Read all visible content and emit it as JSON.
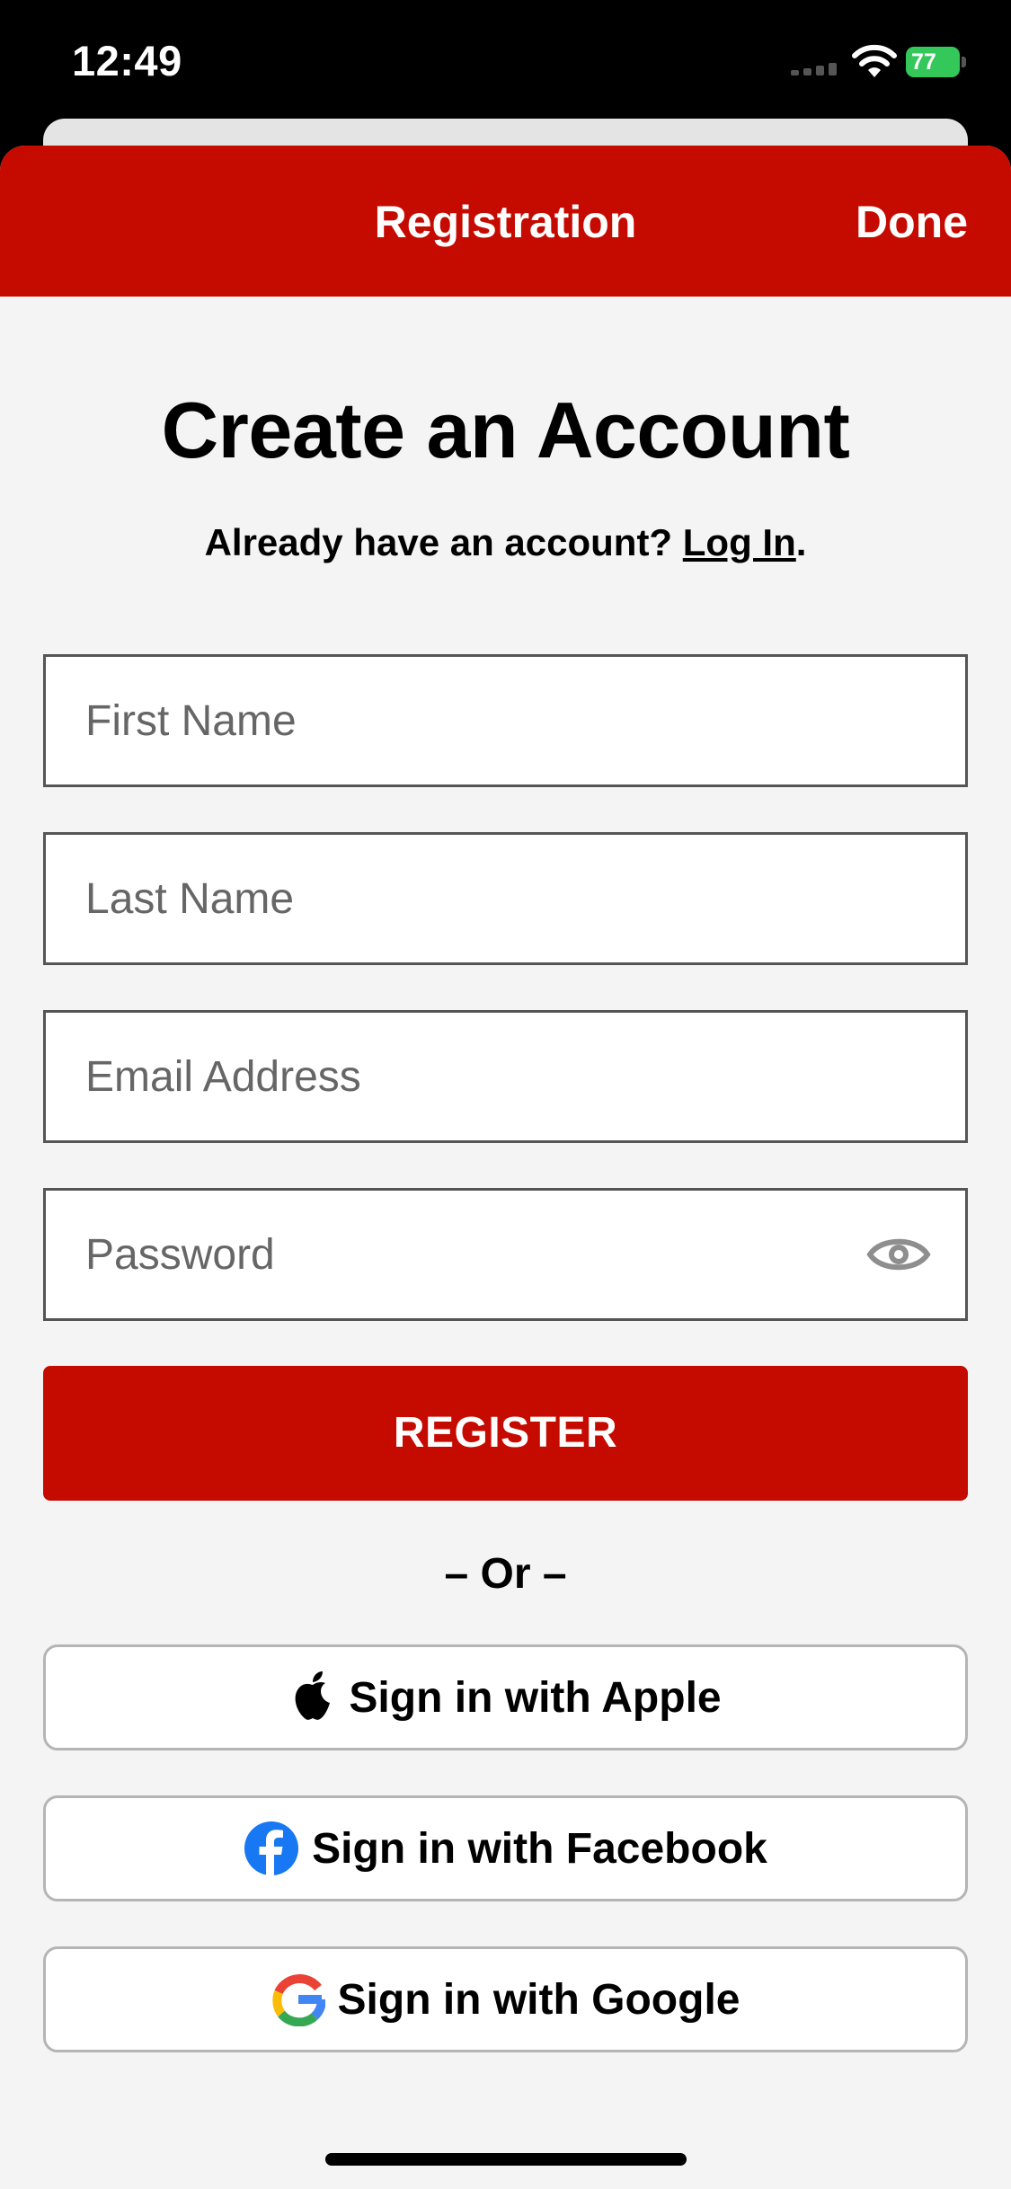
{
  "status_bar": {
    "time": "12:49",
    "battery_level": "77",
    "icons": [
      "signal-icon",
      "wifi-icon",
      "battery-charging-icon"
    ]
  },
  "nav": {
    "title": "Registration",
    "done_label": "Done"
  },
  "heading": "Create an Account",
  "subheading": {
    "prefix": "Already have an account? ",
    "link": "Log In",
    "suffix": "."
  },
  "fields": {
    "first_name": {
      "value": "",
      "placeholder": "First Name"
    },
    "last_name": {
      "value": "",
      "placeholder": "Last Name"
    },
    "email": {
      "value": "",
      "placeholder": "Email Address"
    },
    "password": {
      "value": "",
      "placeholder": "Password",
      "toggle_icon": "eye-icon"
    }
  },
  "register_label": "REGISTER",
  "or_label": "– Or –",
  "social": {
    "apple": {
      "label": "Sign in with Apple",
      "icon": "apple-icon"
    },
    "facebook": {
      "label": "Sign in with Facebook",
      "icon": "facebook-icon"
    },
    "google": {
      "label": "Sign in with Google",
      "icon": "google-icon"
    }
  },
  "colors": {
    "brand_red": "#c50a00",
    "background": "#f4f4f4",
    "field_border": "#555555",
    "facebook_blue": "#1877f2"
  }
}
